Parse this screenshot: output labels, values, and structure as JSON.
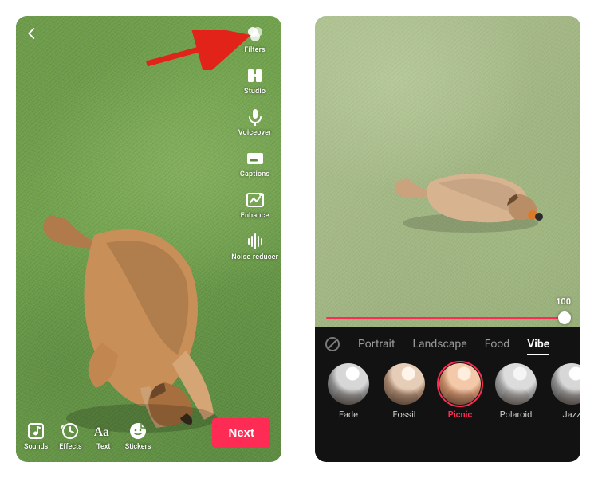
{
  "accent": "#fe2c55",
  "screen1": {
    "right_rail": [
      {
        "id": "filters",
        "label": "Filters"
      },
      {
        "id": "studio",
        "label": "Studio"
      },
      {
        "id": "voiceover",
        "label": "Voiceover"
      },
      {
        "id": "captions",
        "label": "Captions"
      },
      {
        "id": "enhance",
        "label": "Enhance"
      },
      {
        "id": "noise",
        "label": "Noise reducer"
      }
    ],
    "bottom_rail": [
      {
        "id": "sounds",
        "label": "Sounds"
      },
      {
        "id": "effects",
        "label": "Effects"
      },
      {
        "id": "text",
        "label": "Text"
      },
      {
        "id": "stickers",
        "label": "Stickers"
      }
    ],
    "next_label": "Next"
  },
  "screen2": {
    "slider_value": "100",
    "categories": [
      "Portrait",
      "Landscape",
      "Food",
      "Vibe"
    ],
    "active_category_index": 3,
    "filters": [
      {
        "name": "Fade",
        "tone": "bw"
      },
      {
        "name": "Fossil",
        "tone": "sep"
      },
      {
        "name": "Picnic",
        "tone": "warm",
        "selected": true
      },
      {
        "name": "Polaroid",
        "tone": "cool"
      },
      {
        "name": "Jazz",
        "tone": "bw"
      }
    ]
  }
}
